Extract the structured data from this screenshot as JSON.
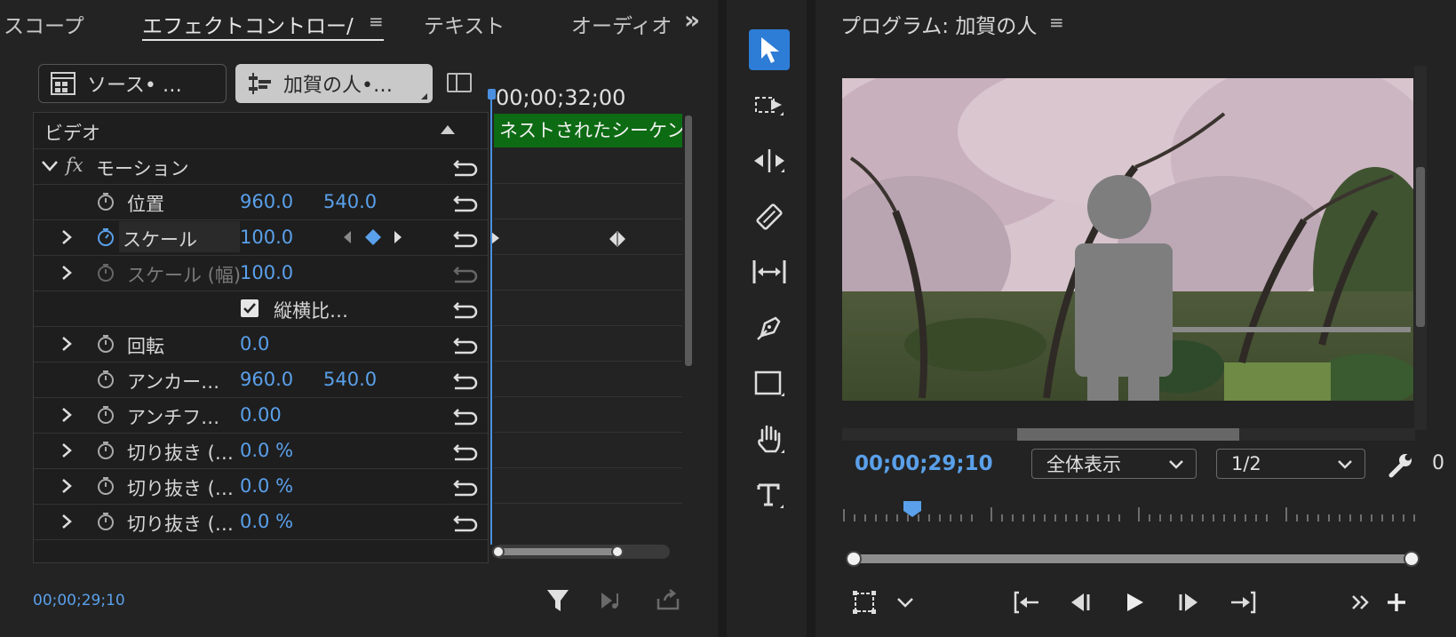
{
  "left_panel": {
    "tabs": [
      {
        "label": "スコープ"
      },
      {
        "label": "エフェクトコントロー/",
        "menu": "≡"
      },
      {
        "label": "テキスト"
      },
      {
        "label": "オーディオ"
      }
    ],
    "overflow_glyph": "»",
    "source_button": "ソース• …",
    "sequence_button": "加賀の人•…",
    "section_label": "ビデオ",
    "motion_label": "モーション",
    "fx_glyph": "fx",
    "properties": [
      {
        "name": "位置",
        "v1": "960.0",
        "v2": "540.0"
      },
      {
        "name": "スケール",
        "v1": "100.0"
      },
      {
        "name": "スケール (幅)",
        "v1": "100.0"
      },
      {
        "name": "縦横比…"
      },
      {
        "name": "回転",
        "v1": "0.0"
      },
      {
        "name": "アンカー…",
        "v1": "960.0",
        "v2": "540.0"
      },
      {
        "name": "アンチフ…",
        "v1": "0.00"
      },
      {
        "name": "切り抜き (…",
        "v1": "0.0 %"
      },
      {
        "name": "切り抜き (…",
        "v1": "0.0 %"
      },
      {
        "name": "切り抜き (…",
        "v1": "0.0 %"
      }
    ],
    "timeline_time": "00;00;32;00",
    "nested_sequence_label": "ネストされたシーケン",
    "timecode": "00;00;29;10"
  },
  "program": {
    "title": "プログラム: 加賀の人",
    "menu": "≡",
    "timecode": "00;00;29;10",
    "zoom_value": "全体表示",
    "resolution_value": "1/2",
    "dropped_frames": "0"
  },
  "colors": {
    "accent_blue": "#2d7cd6",
    "value_blue": "#5aa0ea",
    "nested_green": "#0d6b13"
  }
}
